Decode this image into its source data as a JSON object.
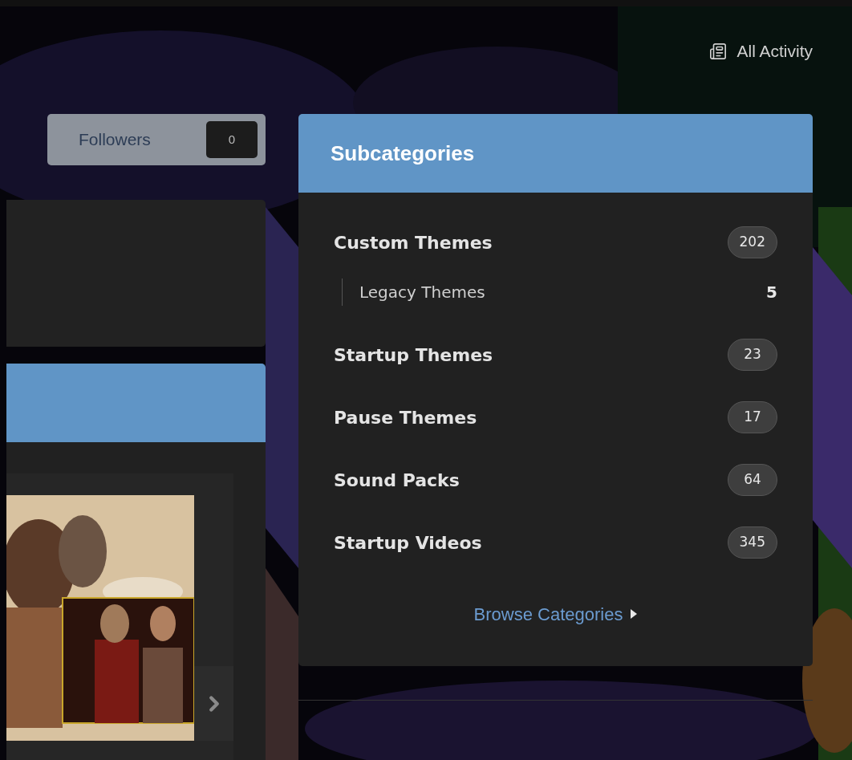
{
  "header": {
    "all_activity": "All Activity"
  },
  "followers": {
    "label": "Followers",
    "count": "0"
  },
  "subcategories": {
    "title": "Subcategories",
    "items": [
      {
        "name": "Custom Themes",
        "count": "202",
        "children": [
          {
            "name": "Legacy Themes",
            "count": "5"
          }
        ]
      },
      {
        "name": "Startup Themes",
        "count": "23"
      },
      {
        "name": "Pause Themes",
        "count": "17"
      },
      {
        "name": "Sound Packs",
        "count": "64"
      },
      {
        "name": "Startup Videos",
        "count": "345"
      }
    ],
    "browse_link": "Browse Categories"
  }
}
